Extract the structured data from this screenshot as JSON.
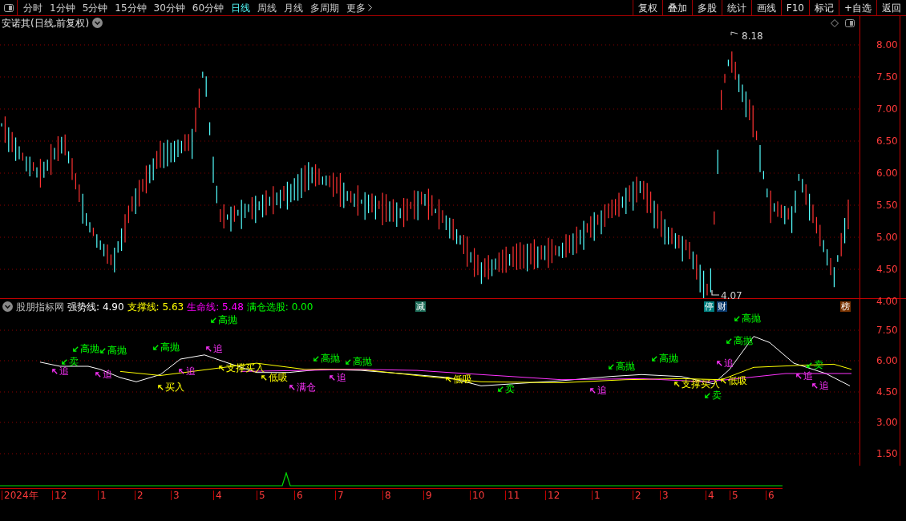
{
  "toolbar": {
    "periods": [
      {
        "label": "分时",
        "selected": false
      },
      {
        "label": "1分钟",
        "selected": false
      },
      {
        "label": "5分钟",
        "selected": false
      },
      {
        "label": "15分钟",
        "selected": false
      },
      {
        "label": "30分钟",
        "selected": false
      },
      {
        "label": "60分钟",
        "selected": false
      },
      {
        "label": "日线",
        "selected": true
      },
      {
        "label": "周线",
        "selected": false
      },
      {
        "label": "月线",
        "selected": false
      },
      {
        "label": "多周期",
        "selected": false
      }
    ],
    "more": "更多",
    "actions": [
      "复权",
      "叠加",
      "多股",
      "统计",
      "画线",
      "F10",
      "标记",
      "+自选",
      "返回"
    ]
  },
  "main_chart": {
    "title": "安诺其(日线,前复权)",
    "high_label": "8.18",
    "low_label": "4.07",
    "yticks": [
      "8.00",
      "7.50",
      "7.00",
      "6.50",
      "6.00",
      "5.50",
      "5.00",
      "4.50",
      "4.00"
    ],
    "events": [
      {
        "label": "减",
        "color": "#1e6e5a"
      },
      {
        "label": "停",
        "color": "#008080"
      },
      {
        "label": "财",
        "color": "#0a3a6e"
      },
      {
        "label": "榜",
        "color": "#7a3300"
      }
    ]
  },
  "indicator": {
    "name": "股朋指标网",
    "series": [
      {
        "name": "强势线:",
        "value": "4.90",
        "color": "#ffffff"
      },
      {
        "name": "支撑线:",
        "value": "5.63",
        "color": "#ffff00"
      },
      {
        "name": "生命线:",
        "value": "5.48",
        "color": "#ff00ff"
      },
      {
        "name": "满仓选股:",
        "value": "0.00",
        "color": "#00ff00"
      }
    ],
    "yticks": [
      "7.50",
      "6.00",
      "4.50",
      "3.00",
      "1.50"
    ],
    "signals": [
      {
        "text": "追",
        "kind": "chase"
      },
      {
        "text": "卖",
        "kind": "sell"
      },
      {
        "text": "高抛",
        "kind": "sell"
      },
      {
        "text": "追",
        "kind": "chase"
      },
      {
        "text": "高抛",
        "kind": "sell"
      },
      {
        "text": "高抛",
        "kind": "sell"
      },
      {
        "text": "买入",
        "kind": "buy"
      },
      {
        "text": "追",
        "kind": "chase"
      },
      {
        "text": "追",
        "kind": "chase"
      },
      {
        "text": "高抛",
        "kind": "sell"
      },
      {
        "text": "支撑买入",
        "kind": "buy"
      },
      {
        "text": "低吸",
        "kind": "buy"
      },
      {
        "text": "满仓",
        "kind": "chase"
      },
      {
        "text": "高抛",
        "kind": "sell"
      },
      {
        "text": "追",
        "kind": "chase"
      },
      {
        "text": "高抛",
        "kind": "sell"
      },
      {
        "text": "低吸",
        "kind": "buy"
      },
      {
        "text": "卖",
        "kind": "sell"
      },
      {
        "text": "追",
        "kind": "chase"
      },
      {
        "text": "高抛",
        "kind": "sell"
      },
      {
        "text": "高抛",
        "kind": "sell"
      },
      {
        "text": "支撑买入",
        "kind": "buy"
      },
      {
        "text": "卖",
        "kind": "sell"
      },
      {
        "text": "追",
        "kind": "chase"
      },
      {
        "text": "低吸",
        "kind": "buy"
      },
      {
        "text": "高抛",
        "kind": "sell"
      },
      {
        "text": "高抛",
        "kind": "sell"
      },
      {
        "text": "追",
        "kind": "chase"
      },
      {
        "text": "卖",
        "kind": "sell"
      },
      {
        "text": "追",
        "kind": "chase"
      }
    ]
  },
  "date_axis": [
    "2024年",
    "12",
    "1",
    "2",
    "3",
    "4",
    "5",
    "6",
    "7",
    "8",
    "9",
    "10",
    "11",
    "12",
    "1",
    "2",
    "3",
    "4",
    "5",
    "6"
  ]
}
